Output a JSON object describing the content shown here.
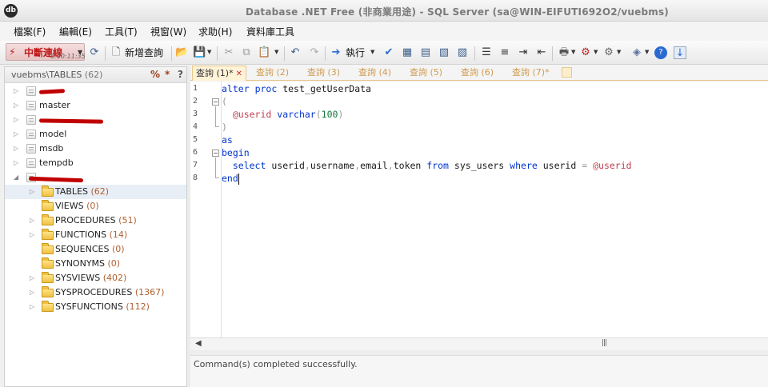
{
  "window": {
    "title": "Database .NET Free (非商業用途)  -  SQL Server (sa@WIN-EIFUTI692O2/vuebms)",
    "app_icon": "db-app-icon"
  },
  "menu": [
    "檔案(F)",
    "編輯(E)",
    "工具(T)",
    "視窗(W)",
    "求助(H)",
    "資料庫工具"
  ],
  "toolbar": {
    "disconnect_label": "中斷連線",
    "timer": "0:00:11:35",
    "new_query_label": "新增查詢",
    "execute_label": "執行"
  },
  "explorer": {
    "title": "vuebms\\TABLES",
    "count": "(62)",
    "btn_percent": "%",
    "btn_star": "*",
    "btn_help": "?",
    "databases": [
      {
        "label": "",
        "redacted": true
      },
      {
        "label": "master"
      },
      {
        "label": "",
        "redacted": true
      },
      {
        "label": "model"
      },
      {
        "label": "msdb"
      },
      {
        "label": "tempdb"
      },
      {
        "label": "",
        "redacted": true,
        "expanded": true
      }
    ],
    "folders": [
      {
        "label": "TABLES",
        "count": "(62)"
      },
      {
        "label": "VIEWS",
        "count": "(0)"
      },
      {
        "label": "PROCEDURES",
        "count": "(51)"
      },
      {
        "label": "FUNCTIONS",
        "count": "(14)"
      },
      {
        "label": "SEQUENCES",
        "count": "(0)"
      },
      {
        "label": "SYNONYMS",
        "count": "(0)"
      },
      {
        "label": "SYSVIEWS",
        "count": "(402)"
      },
      {
        "label": "SYSPROCEDURES",
        "count": "(1367)"
      },
      {
        "label": "SYSFUNCTIONS",
        "count": "(112)"
      }
    ]
  },
  "tabs": [
    {
      "label": "查詢 (1)*",
      "active": true
    },
    {
      "label": "查詢 (2)"
    },
    {
      "label": "查詢 (3)"
    },
    {
      "label": "查詢 (4)"
    },
    {
      "label": "查詢 (5)"
    },
    {
      "label": "查詢 (6)"
    },
    {
      "label": "查詢 (7)*"
    }
  ],
  "editor": {
    "line_numbers": [
      "1",
      "2",
      "3",
      "4",
      "5",
      "6",
      "7",
      "8"
    ],
    "lines": [
      {
        "kw1": "alter",
        "kw2": "proc",
        "name": "test_getUserData"
      },
      {
        "text": "("
      },
      {
        "param": "@userid",
        "type": "varchar",
        "open": "(",
        "num": "100",
        "close": ")"
      },
      {
        "text": ")"
      },
      {
        "kw": "as"
      },
      {
        "kw": "begin"
      },
      {
        "select": "select",
        "cols": [
          "userid",
          "username",
          "email",
          "token"
        ],
        "from": "from",
        "table": "sys_users",
        "where": "where",
        "col": "userid",
        "op": "=",
        "param": "@userid"
      },
      {
        "kw": "end"
      }
    ]
  },
  "output": {
    "message": "Command(s) completed successfully."
  }
}
